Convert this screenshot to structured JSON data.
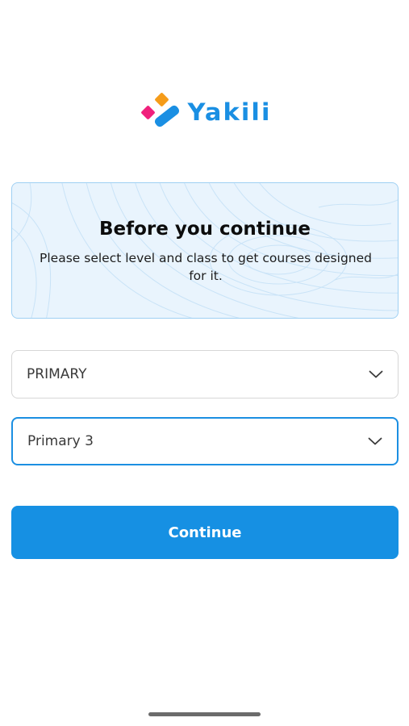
{
  "app": {
    "logo_text": "Yakili",
    "logo_colors": [
      "#f0207c",
      "#f59c1a",
      "#1a8fe3"
    ]
  },
  "info_card": {
    "title": "Before you continue",
    "description": "Please select level and class to get courses designed for it."
  },
  "form": {
    "level_select": {
      "value": "PRIMARY",
      "icon": "chevron-down-icon"
    },
    "class_select": {
      "value": "Primary 3",
      "icon": "chevron-down-icon"
    },
    "continue_label": "Continue"
  },
  "colors": {
    "accent": "#1690e3",
    "card_background": "#e9f4fd",
    "card_border": "#9fd0f3",
    "focused_border": "#1b8fe2"
  }
}
